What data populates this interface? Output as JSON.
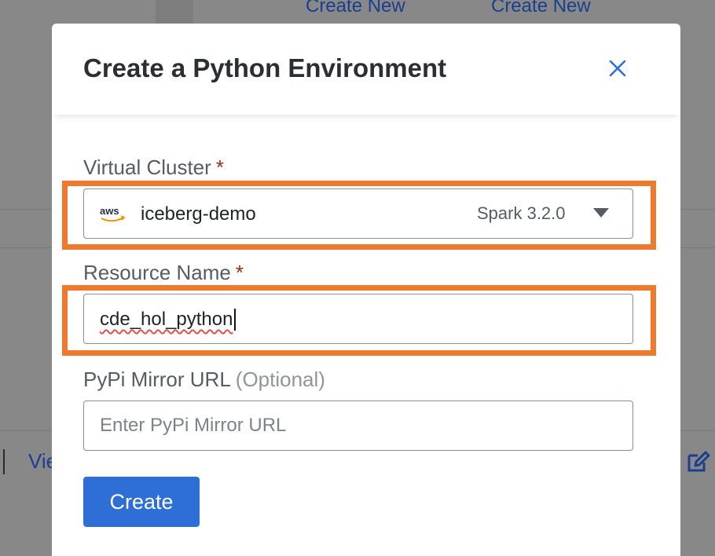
{
  "background": {
    "links": [
      "Create New",
      "Create New"
    ],
    "view_link": "Vie",
    "edit_icon": "edit-icon"
  },
  "modal": {
    "title": "Create a Python Environment",
    "close_icon": "close-icon",
    "virtual_cluster": {
      "label": "Virtual Cluster",
      "required": "*",
      "provider_icon": "aws-logo-icon",
      "provider_text": "aws",
      "value": "iceberg-demo",
      "version": "Spark 3.2.0",
      "caret_icon": "chevron-down-icon"
    },
    "resource_name": {
      "label": "Resource Name",
      "required": "*",
      "value": "cde_hol_python"
    },
    "pypi_mirror": {
      "label": "PyPi Mirror URL",
      "optional": "(Optional)",
      "value": "",
      "placeholder": "Enter PyPi Mirror URL"
    },
    "create_label": "Create"
  },
  "colors": {
    "primary": "#2d6fd6",
    "highlight": "#ef7a2e",
    "required": "#9c2a1a",
    "overlay": "#888888"
  }
}
